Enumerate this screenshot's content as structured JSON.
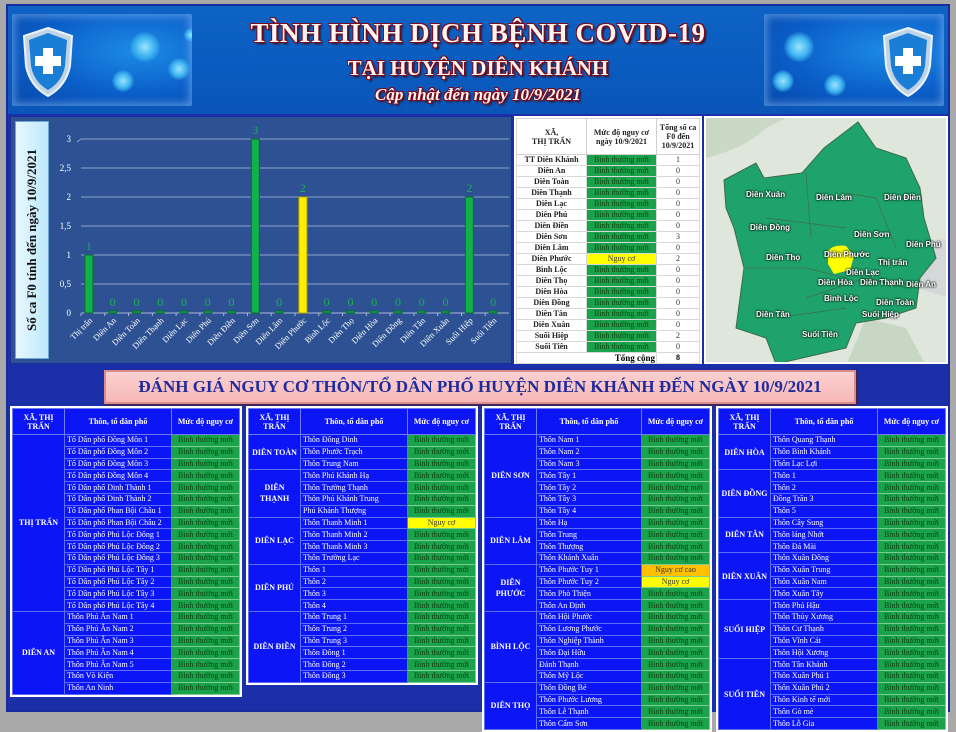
{
  "header": {
    "title": "TÌNH HÌNH DỊCH BỆNH COVID-19",
    "subtitle": "TẠI HUYỆN DIÊN KHÁNH",
    "updated": "Cập nhật đến ngày  10/9/2021",
    "left_icon": "shield-cross-icon",
    "right_icon": "shield-cross-icon"
  },
  "colors": {
    "normal": "#1aa34a",
    "risk": "#ffff00",
    "high_risk": "#ffc000",
    "panel_blue": "#0b15f5",
    "chart_bg": "#2d5193"
  },
  "chart_data": {
    "type": "bar",
    "title": "",
    "xlabel": "",
    "ylabel": "Số ca F0 tính  đến ngày 10/9/2021",
    "categories": [
      "Thị trấn",
      "Diên An",
      "Diên Toàn",
      "Diên Thạnh",
      "Diên Lạc",
      "Diên Phú",
      "Diên Điền",
      "Diên Sơn",
      "Diên Lâm",
      "Diên Phước",
      "Bình Lộc",
      "Diên Thọ",
      "Diên Hòa",
      "Diên Đồng",
      "Diên Tân",
      "Diên Xuân",
      "Suối Hiệp",
      "Suối Tiên"
    ],
    "values": [
      1,
      0,
      0,
      0,
      0,
      0,
      0,
      3,
      0,
      2,
      0,
      0,
      0,
      0,
      0,
      0,
      2,
      0
    ],
    "bar_colors": [
      "green",
      "green",
      "green",
      "green",
      "green",
      "green",
      "green",
      "green",
      "green",
      "yellow",
      "green",
      "green",
      "green",
      "green",
      "green",
      "green",
      "green",
      "green"
    ],
    "ylim": [
      0,
      3
    ],
    "yticks": [
      "0",
      "0,5",
      "1",
      "1,5",
      "2",
      "2,5",
      "3"
    ],
    "ytick_values": [
      0,
      0.5,
      1,
      1.5,
      2,
      2.5,
      3
    ],
    "grid": true,
    "data_labels": true
  },
  "summary": {
    "headers": [
      "XÃ,\nTHỊ TRẤN",
      "Mức độ nguy cơ ngày 10/9/2021",
      "Tổng số ca F0 đến 10/9/2021"
    ],
    "rows": [
      {
        "name": "TT Diên Khánh",
        "level": "Bình thường mới",
        "count": "1",
        "color": "green"
      },
      {
        "name": "Diên An",
        "level": "Bình thường mới",
        "count": "0",
        "color": "green"
      },
      {
        "name": "Diên Toàn",
        "level": "Bình thường mới",
        "count": "0",
        "color": "green"
      },
      {
        "name": "Diên Thạnh",
        "level": "Bình thường mới",
        "count": "0",
        "color": "green"
      },
      {
        "name": "Diên Lạc",
        "level": "Bình thường mới",
        "count": "0",
        "color": "green"
      },
      {
        "name": "Diên Phú",
        "level": "Bình thường mới",
        "count": "0",
        "color": "green"
      },
      {
        "name": "Diên Điền",
        "level": "Bình thường mới",
        "count": "0",
        "color": "green"
      },
      {
        "name": "Diên Sơn",
        "level": "Bình thường mới",
        "count": "3",
        "color": "green"
      },
      {
        "name": "Diên Lâm",
        "level": "Bình thường mới",
        "count": "0",
        "color": "green"
      },
      {
        "name": "Diên Phước",
        "level": "Nguy cơ",
        "count": "2",
        "color": "yellow"
      },
      {
        "name": "Bình Lộc",
        "level": "Bình thường mới",
        "count": "0",
        "color": "green"
      },
      {
        "name": "Diên Thọ",
        "level": "Bình thường mới",
        "count": "0",
        "color": "green"
      },
      {
        "name": "Diên Hòa",
        "level": "Bình thường mới",
        "count": "0",
        "color": "green"
      },
      {
        "name": "Diên Đồng",
        "level": "Bình thường mới",
        "count": "0",
        "color": "green"
      },
      {
        "name": "Diên Tân",
        "level": "Bình thường mới",
        "count": "0",
        "color": "green"
      },
      {
        "name": "Diên Xuân",
        "level": "Bình thường mới",
        "count": "0",
        "color": "green"
      },
      {
        "name": "Suối Hiệp",
        "level": "Bình thường mới",
        "count": "2",
        "color": "green"
      },
      {
        "name": "Suối Tiên",
        "level": "Bình thường mới",
        "count": "0",
        "color": "green"
      }
    ],
    "total_label": "Tổng cộng",
    "total_value": "8"
  },
  "map": {
    "labels": [
      "Diên Xuân",
      "Diên Lâm",
      "Diên Điền",
      "Diên Đồng",
      "Diên Sơn",
      "Diên Phú",
      "Diên Thọ",
      "Diên Phước",
      "Thị trấn",
      "Diên Lạc",
      "Diên Hòa",
      "Diên Thạnh",
      "Diên An",
      "Bình Lộc",
      "Diên Toàn",
      "Diên Tân",
      "Suối Hiệp",
      "Suối Tiên"
    ]
  },
  "section_title": "ĐÁNH GIÁ NGUY CƠ THÔN/TỔ DÂN PHỐ HUYỆN DIÊN KHÁNH ĐẾN NGÀY 10/9/2021",
  "detail_headers": {
    "commune": "XÃ, THỊ TRẤN",
    "village": "Thôn, tổ dân phố",
    "risk": "Mức độ nguy cơ"
  },
  "detail_tables": [
    {
      "groups": [
        {
          "commune": "THỊ TRẤN",
          "villages": [
            {
              "name": "Tổ Dân phố Đồng Môn 1",
              "risk": "Bình thường mới",
              "color": "green"
            },
            {
              "name": "Tổ Dân phố Đồng Môn 2",
              "risk": "Bình thường mới",
              "color": "green"
            },
            {
              "name": "Tổ Dân phố Đồng Môn 3",
              "risk": "Bình thường mới",
              "color": "green"
            },
            {
              "name": "Tổ Dân phố Đồng Môn 4",
              "risk": "Bình thường mới",
              "color": "green"
            },
            {
              "name": "Tổ Dân phố Dinh Thành 1",
              "risk": "Bình thường mới",
              "color": "green"
            },
            {
              "name": "Tổ Dân phố Dinh Thành 2",
              "risk": "Bình thường mới",
              "color": "green"
            },
            {
              "name": "Tổ Dân phố Phan Bội Châu 1",
              "risk": "Bình thường mới",
              "color": "green"
            },
            {
              "name": "Tổ Dân phố Phan Bội Châu 2",
              "risk": "Bình thường mới",
              "color": "green"
            },
            {
              "name": "Tổ Dân phố Phú Lộc Đông 1",
              "risk": "Bình thường mới",
              "color": "green"
            },
            {
              "name": "Tổ Dân phố Phú Lộc Đông 2",
              "risk": "Bình thường mới",
              "color": "green"
            },
            {
              "name": "Tổ Dân phố Phú Lộc Đông 3",
              "risk": "Bình thường mới",
              "color": "green"
            },
            {
              "name": "Tổ Dân phố Phú Lộc Tây 1",
              "risk": "Bình thường mới",
              "color": "green"
            },
            {
              "name": "Tổ Dân phố Phú Lộc Tây 2",
              "risk": "Bình thường mới",
              "color": "green"
            },
            {
              "name": "Tổ Dân phố Phú Lộc Tây 3",
              "risk": "Bình thường mới",
              "color": "green"
            },
            {
              "name": "Tổ Dân phố Phú Lộc Tây 4",
              "risk": "Bình thường mới",
              "color": "green"
            }
          ]
        },
        {
          "commune": "DIÊN AN",
          "villages": [
            {
              "name": "Thôn Phú Ân Nam 1",
              "risk": "Bình thường mới",
              "color": "green"
            },
            {
              "name": "Thôn Phú Ân Nam 2",
              "risk": "Bình thường mới",
              "color": "green"
            },
            {
              "name": "Thôn Phú Ân Nam 3",
              "risk": "Bình thường mới",
              "color": "green"
            },
            {
              "name": "Thôn Phú Ân Nam  4",
              "risk": "Bình thường mới",
              "color": "green"
            },
            {
              "name": "Thôn Phú Ân Nam  5",
              "risk": "Bình thường mới",
              "color": "green"
            },
            {
              "name": "Thôn Võ Kiện",
              "risk": "Bình thường mới",
              "color": "green"
            },
            {
              "name": "Thôn An Ninh",
              "risk": "Bình thường mới",
              "color": "green"
            }
          ]
        }
      ]
    },
    {
      "groups": [
        {
          "commune": "DIÊN TOÀN",
          "villages": [
            {
              "name": "Thôn Đông Dinh",
              "risk": "Bình thường mới",
              "color": "green"
            },
            {
              "name": "Thôn Phước Trạch",
              "risk": "Bình thường mới",
              "color": "green"
            },
            {
              "name": "Thôn Trung Nam",
              "risk": "Bình thường mới",
              "color": "green"
            }
          ]
        },
        {
          "commune": "DIÊN THẠNH",
          "villages": [
            {
              "name": "Thôn Phú Khánh Hạ",
              "risk": "Bình thường mới",
              "color": "green"
            },
            {
              "name": "Thôn Trường Thạnh",
              "risk": "Bình thường mới",
              "color": "green"
            },
            {
              "name": "Thôn Phú Khánh Trung",
              "risk": "Bình thường mới",
              "color": "green"
            },
            {
              "name": "Phú Khánh Thượng",
              "risk": "Bình thường mới",
              "color": "green"
            }
          ]
        },
        {
          "commune": "DIÊN LẠC",
          "villages": [
            {
              "name": "Thôn Thanh Minh 1",
              "risk": "Nguy cơ",
              "color": "yellow"
            },
            {
              "name": "Thôn Thanh Minh 2",
              "risk": "Bình thường mới",
              "color": "green"
            },
            {
              "name": "Thôn Thanh Minh 3",
              "risk": "Bình thường mới",
              "color": "green"
            },
            {
              "name": "Thôn Trường Lạc",
              "risk": "Bình thường mới",
              "color": "green"
            }
          ]
        },
        {
          "commune": "DIÊN PHÚ",
          "villages": [
            {
              "name": "Thôn 1",
              "risk": "Bình thường mới",
              "color": "green"
            },
            {
              "name": "Thôn 2",
              "risk": "Bình thường mới",
              "color": "green"
            },
            {
              "name": "Thôn 3",
              "risk": "Bình thường mới",
              "color": "green"
            },
            {
              "name": "Thôn 4",
              "risk": "Bình thường mới",
              "color": "green"
            }
          ]
        },
        {
          "commune": "DIÊN ĐIỀN",
          "villages": [
            {
              "name": "Thôn Trung 1",
              "risk": "Bình thường mới",
              "color": "green"
            },
            {
              "name": "Thôn Trung 2",
              "risk": "Bình thường mới",
              "color": "green"
            },
            {
              "name": "Thôn Trung 3",
              "risk": "Bình thường mới",
              "color": "green"
            },
            {
              "name": "Thôn Đông 1",
              "risk": "Bình thường mới",
              "color": "green"
            },
            {
              "name": "Thôn Đông 2",
              "risk": "Bình thường mới",
              "color": "green"
            },
            {
              "name": "Thôn Đông 3",
              "risk": "Bình thường mới",
              "color": "green"
            }
          ]
        }
      ]
    },
    {
      "groups": [
        {
          "commune": "DIÊN SƠN",
          "villages": [
            {
              "name": "Thôn Nam 1",
              "risk": "Bình thường mới",
              "color": "green"
            },
            {
              "name": "Thôn Nam 2",
              "risk": "Bình thường mới",
              "color": "green"
            },
            {
              "name": "Thôn Nam 3",
              "risk": "Bình thường mới",
              "color": "green"
            },
            {
              "name": "Thôn Tây 1",
              "risk": "Bình thường mới",
              "color": "green"
            },
            {
              "name": "Thôn Tây 2",
              "risk": "Bình thường mới",
              "color": "green"
            },
            {
              "name": "Thôn Tây 3",
              "risk": "Bình thường mới",
              "color": "green"
            },
            {
              "name": "Thôn Tây 4",
              "risk": "Bình thường mới",
              "color": "green"
            }
          ]
        },
        {
          "commune": "DIÊN LÂM",
          "villages": [
            {
              "name": "Thôn Hạ",
              "risk": "Bình thường mới",
              "color": "green"
            },
            {
              "name": "Thôn Trung",
              "risk": "Bình thường mới",
              "color": "green"
            },
            {
              "name": "Thôn Thượng",
              "risk": "Bình thường mới",
              "color": "green"
            },
            {
              "name": "Thôn Khánh Xuân",
              "risk": "Bình thường mới",
              "color": "green"
            }
          ]
        },
        {
          "commune": "DIÊN PHƯỚC",
          "villages": [
            {
              "name": "Thôn Phước Tuy 1",
              "risk": "Nguy cơ cao",
              "color": "orange"
            },
            {
              "name": "Thôn Phước Tuy 2",
              "risk": "Nguy cơ",
              "color": "yellow"
            },
            {
              "name": "Thôn Phò Thiện",
              "risk": "Bình thường mới",
              "color": "green"
            },
            {
              "name": "Thôn An Định",
              "risk": "Bình thường mới",
              "color": "green"
            }
          ]
        },
        {
          "commune": "BÌNH LỘC",
          "villages": [
            {
              "name": "Thôn Hội Phước",
              "risk": "Bình thường mới",
              "color": "green"
            },
            {
              "name": "Thôn Lương Phước",
              "risk": "Bình thường mới",
              "color": "green"
            },
            {
              "name": "Thôn Nghiệp Thành",
              "risk": "Bình thường mới",
              "color": "green"
            },
            {
              "name": "Thôn Đại Hữu",
              "risk": "Bình thường mới",
              "color": "green"
            },
            {
              "name": "Đảnh Thạnh",
              "risk": "Bình thường mới",
              "color": "green"
            },
            {
              "name": "Thôn Mỹ Lộc",
              "risk": "Bình thường mới",
              "color": "green"
            }
          ]
        },
        {
          "commune": "DIÊN THỌ",
          "villages": [
            {
              "name": "Thôn Đồng Bé",
              "risk": "Bình thường mới",
              "color": "green"
            },
            {
              "name": "Thôn Phước Lương",
              "risk": "Bình thường mới",
              "color": "green"
            },
            {
              "name": "Thôn Lễ Thạnh",
              "risk": "Bình thường mới",
              "color": "green"
            },
            {
              "name": "Thôn Cẩm Sơn",
              "risk": "Bình thường mới",
              "color": "green"
            }
          ]
        }
      ]
    },
    {
      "groups": [
        {
          "commune": "DIÊN HÒA",
          "villages": [
            {
              "name": "Thôn Quang Thạnh",
              "risk": "Bình thường mới",
              "color": "green"
            },
            {
              "name": "Thôn Bình Khánh",
              "risk": "Bình thường mới",
              "color": "green"
            },
            {
              "name": "Thôn Lạc Lợi",
              "risk": "Bình thường mới",
              "color": "green"
            }
          ]
        },
        {
          "commune": "DIÊN ĐỒNG",
          "villages": [
            {
              "name": "Thôn 1",
              "risk": "Bình thường mới",
              "color": "green"
            },
            {
              "name": "Thôn 2",
              "risk": "Bình thường mới",
              "color": "green"
            },
            {
              "name": "Đồng Trăn 3",
              "risk": "Bình thường mới",
              "color": "green"
            },
            {
              "name": "Thôn 5",
              "risk": "Bình thường mới",
              "color": "green"
            }
          ]
        },
        {
          "commune": "DIÊN TÂN",
          "villages": [
            {
              "name": "Thôn Cây Sung",
              "risk": "Bình thường mới",
              "color": "green"
            },
            {
              "name": "Thôn láng Nhớt",
              "risk": "Bình thường mới",
              "color": "green"
            },
            {
              "name": "Thôn Đá Mài",
              "risk": "Bình thường mới",
              "color": "green"
            }
          ]
        },
        {
          "commune": "DIÊN XUÂN",
          "villages": [
            {
              "name": "Thôn Xuân Đông",
              "risk": "Bình thường mới",
              "color": "green"
            },
            {
              "name": "Thôn Xuân Trung",
              "risk": "Bình thường mới",
              "color": "green"
            },
            {
              "name": "Thôn Xuân Nam",
              "risk": "Bình thường mới",
              "color": "green"
            },
            {
              "name": "Thôn Xuân Tây",
              "risk": "Bình thường mới",
              "color": "green"
            }
          ]
        },
        {
          "commune": "SUỐI HIỆP",
          "villages": [
            {
              "name": "Thôn Phú Hậu",
              "risk": "Bình thường mới",
              "color": "green"
            },
            {
              "name": "Thôn Thủy Xương",
              "risk": "Bình thường mới",
              "color": "green"
            },
            {
              "name": "Thôn Cư Thạnh",
              "risk": "Bình thường mới",
              "color": "green"
            },
            {
              "name": "Thôn Vĩnh Cát",
              "risk": "Bình thường mới",
              "color": "green"
            },
            {
              "name": "Thôn Hội Xương",
              "risk": "Bình thường mới",
              "color": "green"
            }
          ]
        },
        {
          "commune": "SUỐI TIÊN",
          "villages": [
            {
              "name": "Thôn Tân Khánh",
              "risk": "Bình thường mới",
              "color": "green"
            },
            {
              "name": "Thôn  Xuân Phú 1",
              "risk": "Bình thường mới",
              "color": "green"
            },
            {
              "name": "Thôn  Xuân Phú 2",
              "risk": "Bình thường mới",
              "color": "green"
            },
            {
              "name": "Thôn Kinh tế mới",
              "risk": "Bình thường mới",
              "color": "green"
            },
            {
              "name": "Thôn Gò mè",
              "risk": "Bình thường mới",
              "color": "green"
            },
            {
              "name": "Thôn Lỗ Gia",
              "risk": "Bình thường mới",
              "color": "green"
            }
          ]
        }
      ]
    }
  ]
}
